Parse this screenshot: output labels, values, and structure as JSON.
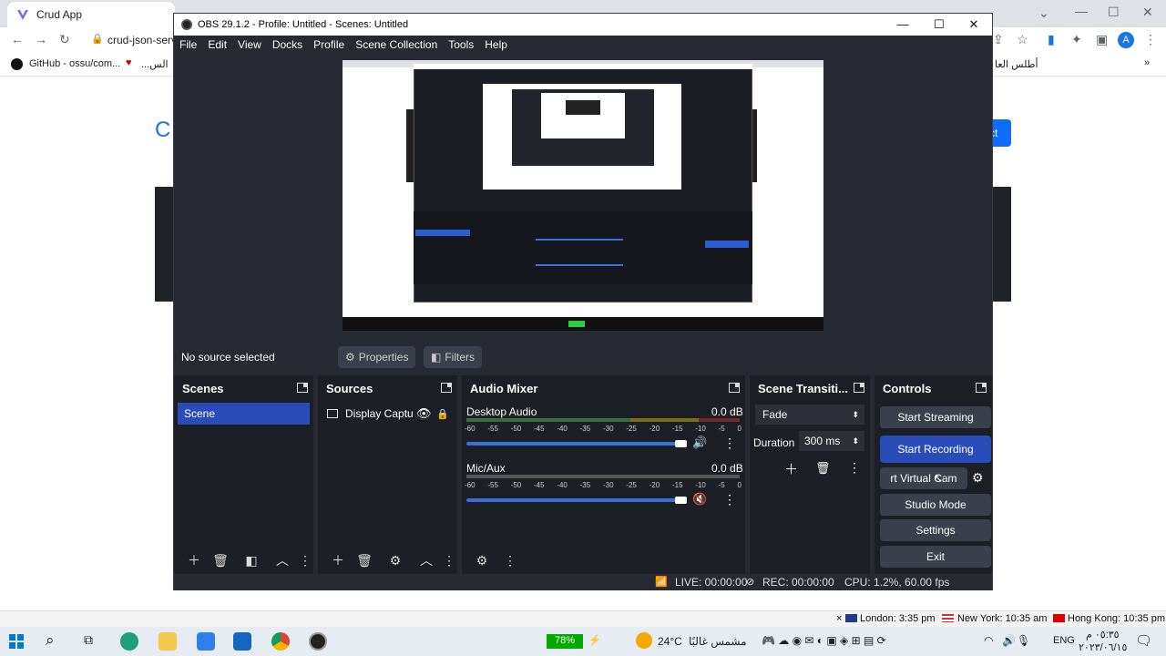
{
  "chrome": {
    "tab_title": "Crud App",
    "address": "crud-json-serv",
    "bookmarks": [
      "GitHub - ossu/com...",
      "...الس"
    ],
    "bookmark_right": "أطلس العا",
    "avatar_letter": "A",
    "page_heading_fragment": "C",
    "page_button_fragment": "ct"
  },
  "obs": {
    "title": "OBS 29.1.2 - Profile: Untitled - Scenes: Untitled",
    "menu": [
      "File",
      "Edit",
      "View",
      "Docks",
      "Profile",
      "Scene Collection",
      "Tools",
      "Help"
    ],
    "no_source": "No source selected",
    "properties_label": "Properties",
    "filters_label": "Filters",
    "scenes": {
      "title": "Scenes",
      "items": [
        "Scene"
      ]
    },
    "sources": {
      "title": "Sources",
      "items": [
        "Display Captu"
      ]
    },
    "mixer": {
      "title": "Audio Mixer",
      "scale": [
        "-60",
        "-55",
        "-50",
        "-45",
        "-40",
        "-35",
        "-30",
        "-25",
        "-20",
        "-15",
        "-10",
        "-5",
        "0"
      ],
      "channels": [
        {
          "name": "Desktop Audio",
          "db": "0.0 dB",
          "muted": false
        },
        {
          "name": "Mic/Aux",
          "db": "0.0 dB",
          "muted": true
        }
      ]
    },
    "transitions": {
      "title": "Scene Transiti...",
      "selected": "Fade",
      "duration_label": "Duration",
      "duration_value": "300 ms"
    },
    "controls": {
      "title": "Controls",
      "start_streaming": "Start Streaming",
      "start_recording": "Start Recording",
      "virtual_cam": "rt Virtual Cam",
      "studio_mode": "Studio Mode",
      "settings": "Settings",
      "exit": "Exit"
    },
    "status": {
      "live": "LIVE: 00:00:00",
      "rec": "REC: 00:00:00",
      "cpu": "CPU: 1.2%, 60.00 fps"
    }
  },
  "clocks": {
    "london": "London: 3:35 pm",
    "newyork": "New York: 10:35 am",
    "hongkong": "Hong Kong: 10:35 pm"
  },
  "taskbar": {
    "battery": "78%",
    "weather_temp": "24°C",
    "weather_text": "مشمس غالبًا",
    "lang": "ENG",
    "time": "٠٥:٣٥ م",
    "date": "٢٠٢٣/٠٦/١٥"
  },
  "colors": {
    "obs_bg": "#272a33",
    "dock_bg": "#1d1f26",
    "accent": "#284cb8",
    "button": "#3c404d"
  }
}
